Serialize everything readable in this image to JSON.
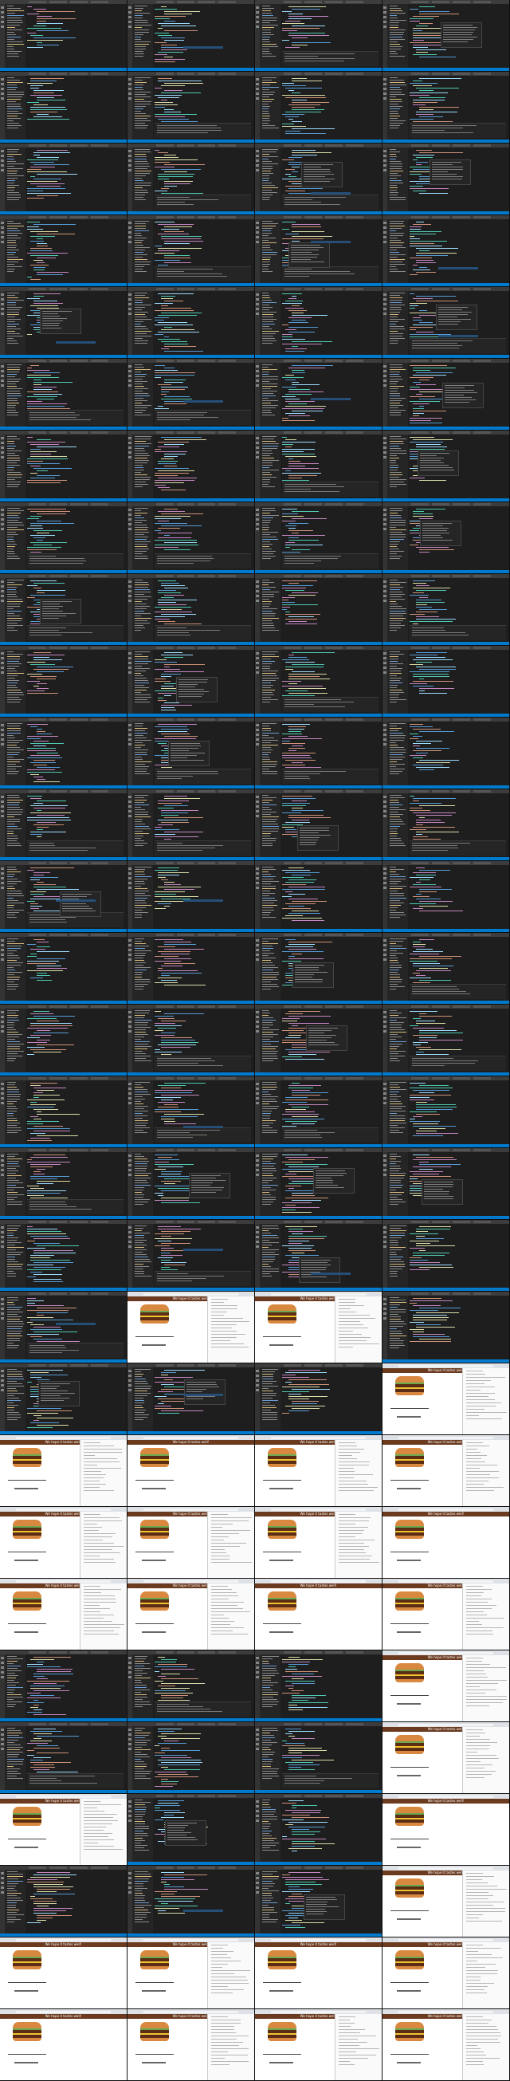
{
  "app": {
    "title": "Visual Studio Code — burger project",
    "browser_page_title": "We hope it tastes well!"
  },
  "frames": [
    "editor",
    "editor",
    "editor",
    "editor",
    "editor",
    "editor",
    "editor",
    "editor",
    "editor",
    "editor",
    "editor",
    "editor",
    "editor",
    "editor",
    "editor",
    "editor",
    "editor",
    "editor",
    "editor",
    "editor",
    "editor",
    "editor",
    "editor",
    "editor",
    "editor",
    "editor",
    "editor",
    "editor",
    "editor",
    "editor",
    "editor",
    "editor",
    "editor",
    "editor",
    "editor",
    "editor",
    "editor",
    "editor",
    "editor",
    "editor",
    "editor",
    "editor",
    "editor",
    "editor",
    "editor",
    "editor",
    "editor",
    "editor",
    "editor",
    "editor",
    "editor",
    "editor",
    "editor",
    "editor",
    "editor",
    "editor",
    "editor",
    "editor",
    "editor",
    "editor",
    "editor",
    "editor",
    "editor",
    "editor",
    "editor",
    "editor",
    "editor",
    "editor",
    "editor",
    "editor",
    "editor",
    "editor",
    "editor",
    "browser",
    "browser",
    "editor",
    "editor",
    "editor",
    "editor",
    "browser",
    "browser",
    "browser",
    "browser",
    "browser",
    "browser",
    "browser",
    "browser",
    "browser",
    "browser",
    "browser",
    "browser",
    "browser",
    "editor",
    "editor",
    "editor",
    "browser",
    "editor",
    "editor",
    "editor",
    "browser",
    "browser",
    "editor",
    "editor",
    "browser",
    "editor",
    "editor",
    "editor",
    "browser",
    "browser",
    "browser",
    "browser",
    "browser",
    "browser",
    "browser",
    "browser",
    "browser"
  ],
  "accent": "#007acc"
}
